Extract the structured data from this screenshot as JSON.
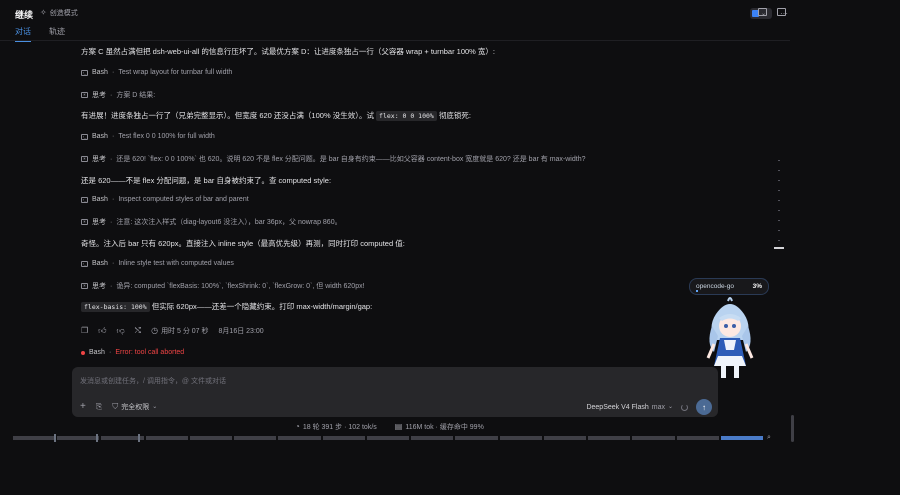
{
  "header": {
    "title": "继续",
    "mode_label": "创造模式"
  },
  "tabs": [
    {
      "label": "对话",
      "active": true
    },
    {
      "label": "轨迹",
      "active": false
    }
  ],
  "messages": {
    "m1": "方案 C 虽然占满但把 dsh-web-ui-all 的信息行压坏了。试最优方案 D：让进度条独占一行（父容器 wrap + turnbar 100% 宽）:",
    "t1_name": "Bash",
    "t1_desc": "Test wrap layout for turnbar full width",
    "t2_name": "思考",
    "t2_desc": "方案 D 结果:",
    "m2a": "有进展！进度条独占一行了（兄弟完整显示）。但宽度 620 还没占满（100% 没生效）。试",
    "m2_code": "flex: 0 0 100%",
    "m2b": "彻底锁死:",
    "t3_name": "Bash",
    "t3_desc": "Test flex 0 0 100% for full width",
    "t4_name": "思考",
    "t4_desc": "还是 620! `flex: 0 0 100%` 也 620。说明 620 不是 flex 分配问题。是 bar 自身有约束——比如父容器 content-box 宽度就是 620? 还是 bar 有 max-width?",
    "m3": "还是 620——不是 flex 分配问题，是 bar 自身被约束了。查 computed style:",
    "t5_name": "Bash",
    "t5_desc": "Inspect computed styles of bar and parent",
    "t6_name": "思考",
    "t6_desc": "注意: 这次注入样式（diag-layout6 没注入），bar 36px，父 nowrap 860。",
    "m4": "奇怪。注入后 bar 只有 620px。直接注入 inline style（最高优先级）再测，同时打印 computed 值:",
    "t7_name": "Bash",
    "t7_desc": "Inline style test with computed values",
    "t8_name": "思考",
    "t8_desc": "诡异: computed `flexBasis: 100%`, `flexShrink: 0`, `flexGrow: 0`, 但 width 620px!",
    "m5_code": "flex-basis: 100%",
    "m5b": "但实际 620px——还差一个隐藏约束。打印 max-width/margin/gap:",
    "elapsed": "用时 5 分 07 秒",
    "date": "8月16日 23:00",
    "t9_name": "Bash",
    "t9_err": "Error: tool call aborted"
  },
  "composer": {
    "placeholder": "发消息或创建任务，/ 调用指令，@ 文件或对话",
    "permission": "完全权限",
    "model": "DeepSeek V4 Flash",
    "effort": "max"
  },
  "stats": {
    "steps": "18 轮 391 步 · 102 tok/s",
    "tokens": "116M tok · 缓存命中 99%"
  },
  "opencode": {
    "name": "opencode-go",
    "percent": "3%",
    "usage_fraction": 0.03
  },
  "colors": {
    "accent": "#4a90e2",
    "error": "#ef4444",
    "background": "#0e0e10"
  },
  "icons": [
    "sparkle-icon",
    "more-icon",
    "monitor-icon",
    "sidebar-icon",
    "terminal-icon",
    "think-icon",
    "copy-icon",
    "thumb-up-icon",
    "thumb-down-icon",
    "branch-icon",
    "clock-icon",
    "plus-icon",
    "attach-icon",
    "shield-icon",
    "send-icon",
    "search-icon"
  ]
}
